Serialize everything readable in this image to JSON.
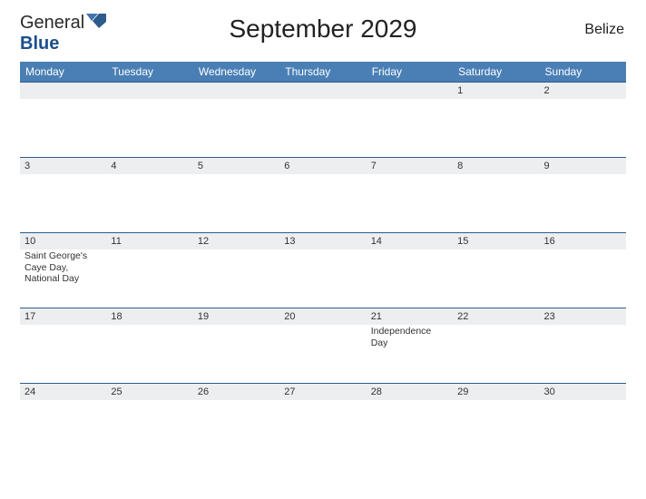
{
  "brand": {
    "part1": "General",
    "part2": "Blue"
  },
  "title": "September 2029",
  "country": "Belize",
  "weekdays": [
    "Monday",
    "Tuesday",
    "Wednesday",
    "Thursday",
    "Friday",
    "Saturday",
    "Sunday"
  ],
  "weeks": [
    {
      "days": [
        {
          "num": "",
          "event": ""
        },
        {
          "num": "",
          "event": ""
        },
        {
          "num": "",
          "event": ""
        },
        {
          "num": "",
          "event": ""
        },
        {
          "num": "",
          "event": ""
        },
        {
          "num": "1",
          "event": ""
        },
        {
          "num": "2",
          "event": ""
        }
      ]
    },
    {
      "days": [
        {
          "num": "3",
          "event": ""
        },
        {
          "num": "4",
          "event": ""
        },
        {
          "num": "5",
          "event": ""
        },
        {
          "num": "6",
          "event": ""
        },
        {
          "num": "7",
          "event": ""
        },
        {
          "num": "8",
          "event": ""
        },
        {
          "num": "9",
          "event": ""
        }
      ]
    },
    {
      "days": [
        {
          "num": "10",
          "event": "Saint George's Caye Day, National Day"
        },
        {
          "num": "11",
          "event": ""
        },
        {
          "num": "12",
          "event": ""
        },
        {
          "num": "13",
          "event": ""
        },
        {
          "num": "14",
          "event": ""
        },
        {
          "num": "15",
          "event": ""
        },
        {
          "num": "16",
          "event": ""
        }
      ]
    },
    {
      "days": [
        {
          "num": "17",
          "event": ""
        },
        {
          "num": "18",
          "event": ""
        },
        {
          "num": "19",
          "event": ""
        },
        {
          "num": "20",
          "event": ""
        },
        {
          "num": "21",
          "event": "Independence Day"
        },
        {
          "num": "22",
          "event": ""
        },
        {
          "num": "23",
          "event": ""
        }
      ]
    },
    {
      "days": [
        {
          "num": "24",
          "event": ""
        },
        {
          "num": "25",
          "event": ""
        },
        {
          "num": "26",
          "event": ""
        },
        {
          "num": "27",
          "event": ""
        },
        {
          "num": "28",
          "event": ""
        },
        {
          "num": "29",
          "event": ""
        },
        {
          "num": "30",
          "event": ""
        }
      ]
    }
  ]
}
